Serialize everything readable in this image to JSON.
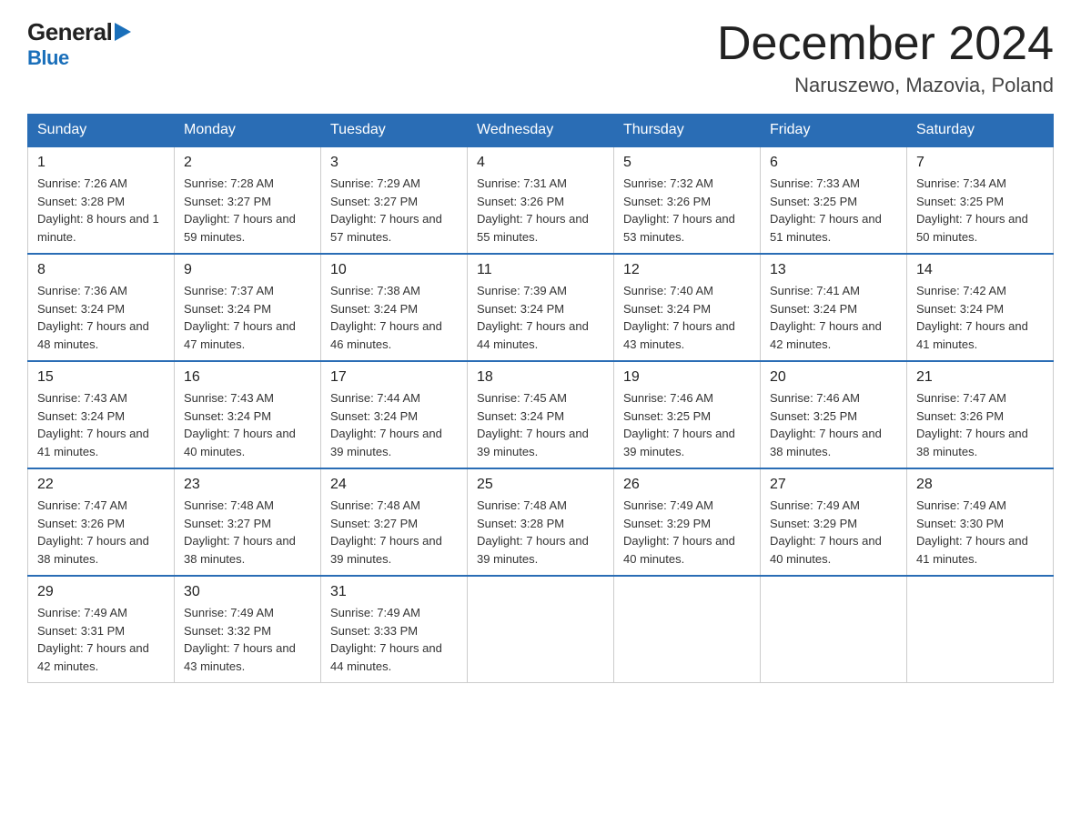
{
  "header": {
    "logo_general": "General",
    "logo_blue": "Blue",
    "month_title": "December 2024",
    "location": "Naruszewo, Mazovia, Poland"
  },
  "days_of_week": [
    "Sunday",
    "Monday",
    "Tuesday",
    "Wednesday",
    "Thursday",
    "Friday",
    "Saturday"
  ],
  "weeks": [
    [
      {
        "day": "1",
        "sunrise": "7:26 AM",
        "sunset": "3:28 PM",
        "daylight": "8 hours and 1 minute."
      },
      {
        "day": "2",
        "sunrise": "7:28 AM",
        "sunset": "3:27 PM",
        "daylight": "7 hours and 59 minutes."
      },
      {
        "day": "3",
        "sunrise": "7:29 AM",
        "sunset": "3:27 PM",
        "daylight": "7 hours and 57 minutes."
      },
      {
        "day": "4",
        "sunrise": "7:31 AM",
        "sunset": "3:26 PM",
        "daylight": "7 hours and 55 minutes."
      },
      {
        "day": "5",
        "sunrise": "7:32 AM",
        "sunset": "3:26 PM",
        "daylight": "7 hours and 53 minutes."
      },
      {
        "day": "6",
        "sunrise": "7:33 AM",
        "sunset": "3:25 PM",
        "daylight": "7 hours and 51 minutes."
      },
      {
        "day": "7",
        "sunrise": "7:34 AM",
        "sunset": "3:25 PM",
        "daylight": "7 hours and 50 minutes."
      }
    ],
    [
      {
        "day": "8",
        "sunrise": "7:36 AM",
        "sunset": "3:24 PM",
        "daylight": "7 hours and 48 minutes."
      },
      {
        "day": "9",
        "sunrise": "7:37 AM",
        "sunset": "3:24 PM",
        "daylight": "7 hours and 47 minutes."
      },
      {
        "day": "10",
        "sunrise": "7:38 AM",
        "sunset": "3:24 PM",
        "daylight": "7 hours and 46 minutes."
      },
      {
        "day": "11",
        "sunrise": "7:39 AM",
        "sunset": "3:24 PM",
        "daylight": "7 hours and 44 minutes."
      },
      {
        "day": "12",
        "sunrise": "7:40 AM",
        "sunset": "3:24 PM",
        "daylight": "7 hours and 43 minutes."
      },
      {
        "day": "13",
        "sunrise": "7:41 AM",
        "sunset": "3:24 PM",
        "daylight": "7 hours and 42 minutes."
      },
      {
        "day": "14",
        "sunrise": "7:42 AM",
        "sunset": "3:24 PM",
        "daylight": "7 hours and 41 minutes."
      }
    ],
    [
      {
        "day": "15",
        "sunrise": "7:43 AM",
        "sunset": "3:24 PM",
        "daylight": "7 hours and 41 minutes."
      },
      {
        "day": "16",
        "sunrise": "7:43 AM",
        "sunset": "3:24 PM",
        "daylight": "7 hours and 40 minutes."
      },
      {
        "day": "17",
        "sunrise": "7:44 AM",
        "sunset": "3:24 PM",
        "daylight": "7 hours and 39 minutes."
      },
      {
        "day": "18",
        "sunrise": "7:45 AM",
        "sunset": "3:24 PM",
        "daylight": "7 hours and 39 minutes."
      },
      {
        "day": "19",
        "sunrise": "7:46 AM",
        "sunset": "3:25 PM",
        "daylight": "7 hours and 39 minutes."
      },
      {
        "day": "20",
        "sunrise": "7:46 AM",
        "sunset": "3:25 PM",
        "daylight": "7 hours and 38 minutes."
      },
      {
        "day": "21",
        "sunrise": "7:47 AM",
        "sunset": "3:26 PM",
        "daylight": "7 hours and 38 minutes."
      }
    ],
    [
      {
        "day": "22",
        "sunrise": "7:47 AM",
        "sunset": "3:26 PM",
        "daylight": "7 hours and 38 minutes."
      },
      {
        "day": "23",
        "sunrise": "7:48 AM",
        "sunset": "3:27 PM",
        "daylight": "7 hours and 38 minutes."
      },
      {
        "day": "24",
        "sunrise": "7:48 AM",
        "sunset": "3:27 PM",
        "daylight": "7 hours and 39 minutes."
      },
      {
        "day": "25",
        "sunrise": "7:48 AM",
        "sunset": "3:28 PM",
        "daylight": "7 hours and 39 minutes."
      },
      {
        "day": "26",
        "sunrise": "7:49 AM",
        "sunset": "3:29 PM",
        "daylight": "7 hours and 40 minutes."
      },
      {
        "day": "27",
        "sunrise": "7:49 AM",
        "sunset": "3:29 PM",
        "daylight": "7 hours and 40 minutes."
      },
      {
        "day": "28",
        "sunrise": "7:49 AM",
        "sunset": "3:30 PM",
        "daylight": "7 hours and 41 minutes."
      }
    ],
    [
      {
        "day": "29",
        "sunrise": "7:49 AM",
        "sunset": "3:31 PM",
        "daylight": "7 hours and 42 minutes."
      },
      {
        "day": "30",
        "sunrise": "7:49 AM",
        "sunset": "3:32 PM",
        "daylight": "7 hours and 43 minutes."
      },
      {
        "day": "31",
        "sunrise": "7:49 AM",
        "sunset": "3:33 PM",
        "daylight": "7 hours and 44 minutes."
      },
      null,
      null,
      null,
      null
    ]
  ],
  "labels": {
    "sunrise": "Sunrise:",
    "sunset": "Sunset:",
    "daylight": "Daylight:"
  }
}
